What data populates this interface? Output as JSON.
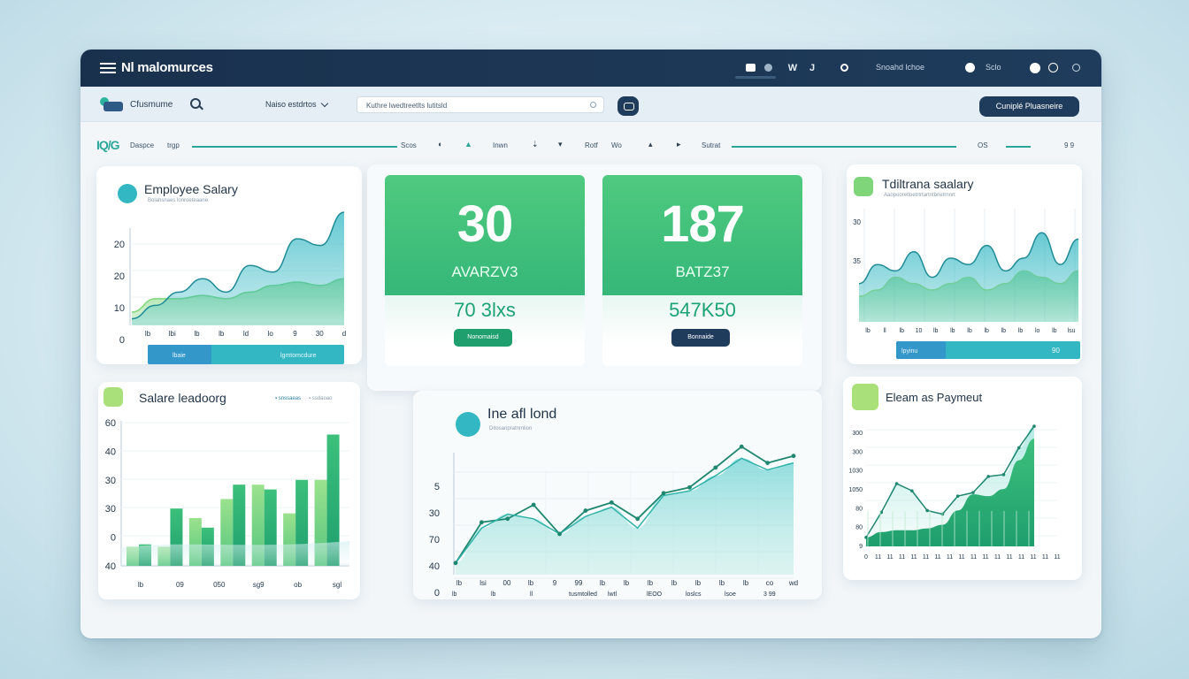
{
  "app": {
    "title": "Nl malomurces"
  },
  "titlebar": {
    "icons": [
      "window-icon",
      "record-icon",
      "w-icon",
      "j-icon",
      "help-icon",
      "globe-icon",
      "notification-icon",
      "status-icon"
    ],
    "w_text": "W",
    "j_text": "J",
    "status_text": "Snoahd lchoe",
    "lang_text": "Sclo",
    "colors": {
      "bar": "#1f3c5c",
      "text": "#ffffff"
    }
  },
  "toolbar": {
    "user_label": "Cfusmume",
    "dropdown_label": "Naiso estdrtos",
    "search_value": "Kuthre lwedtreetlts  lutitsld",
    "cta_label": "Cuniplé Pluasneire"
  },
  "filterbar": {
    "logo": "IQ/G",
    "items": [
      "Daspce",
      "trgp",
      "Scos",
      "Inwn",
      "Rotf",
      "Wo",
      "Sutrat",
      "OS"
    ],
    "page_indicator": "9 9"
  },
  "employee_salary": {
    "title": "Employee Salary",
    "subtitle": "Bolahsnaes lonroeteaane",
    "yticks": [
      "20",
      "20",
      "10",
      "0"
    ],
    "xticks": [
      "lb",
      "lbi",
      "lb",
      "lb",
      "ld",
      "lo",
      "9",
      "30",
      "d"
    ],
    "footer": [
      "lbaie",
      "lgmtomcdure"
    ],
    "chart_data": {
      "type": "area",
      "series": [
        {
          "values": [
            2,
            6,
            10,
            14,
            10,
            18,
            16,
            26,
            24,
            34
          ]
        },
        {
          "values": [
            4,
            8,
            8,
            9,
            8,
            10,
            12,
            13,
            12,
            14
          ]
        }
      ]
    },
    "colors": {
      "teal": "#33b8c3",
      "green": "#7fd67a"
    }
  },
  "stats": [
    {
      "value": "30",
      "label": "AVARZV3",
      "sub": "70 3lxs",
      "button": "Nonomaisd"
    },
    {
      "value": "187",
      "label": "BATZ37",
      "sub": "547K50",
      "button": "Bonnaide"
    }
  ],
  "traditional_salary": {
    "title": "Tdiltrana saalary",
    "subtitle": "Aaopooretloetrtrtartntbnetrnnrt",
    "yticks": [
      "30",
      "35"
    ],
    "xticks": [
      "lb",
      "ll",
      "lb",
      "10",
      "lb",
      "lb",
      "lb",
      "lb",
      "lb",
      "lb",
      "lo",
      "lb",
      "lsu"
    ],
    "footer": [
      "lpyinu",
      "90"
    ],
    "chart_data": {
      "type": "area",
      "series": [
        {
          "values": [
            12,
            18,
            16,
            22,
            14,
            20,
            18,
            24,
            16,
            20,
            28,
            18,
            26
          ]
        },
        {
          "values": [
            8,
            10,
            14,
            12,
            10,
            12,
            14,
            10,
            12,
            16,
            14,
            12,
            16
          ]
        }
      ]
    }
  },
  "salary_leadership": {
    "title": "Salare leadoorg",
    "legend": [
      "▪ snssaeas",
      "▪ ssdaoao"
    ],
    "yticks": [
      "60",
      "40",
      "30",
      "30",
      "0",
      "40"
    ],
    "xticks": [
      "lb",
      "09",
      "050",
      "sg9",
      "ob",
      "sgl"
    ],
    "chart_data": {
      "type": "bar",
      "series": [
        {
          "name": "light",
          "values": [
            8,
            8,
            20,
            28,
            34,
            22,
            36
          ]
        },
        {
          "name": "dark",
          "values": [
            9,
            24,
            16,
            34,
            32,
            36,
            55
          ]
        }
      ]
    }
  },
  "line_trend": {
    "title": "Ine afl lond",
    "subtitle": "Ditosanpratnmlion",
    "yticks": [
      "5",
      "30",
      "70",
      "40",
      "0"
    ],
    "xticks": [
      "lb",
      "lsi",
      "00",
      "lb",
      "9",
      "99",
      "lb",
      "lb",
      "lb",
      "lb",
      "lb",
      "lb",
      "lb",
      "co",
      "wd"
    ],
    "footer": [
      "lb",
      "lb",
      "ll",
      "tusmtolled",
      "lwtl",
      "lEOO",
      "loslcs",
      "lsoe",
      "3 99"
    ],
    "chart_data": {
      "type": "line",
      "series": [
        {
          "name": "a",
          "values": [
            10,
            45,
            48,
            60,
            35,
            55,
            62,
            48,
            70,
            75,
            92,
            110,
            96,
            102
          ]
        },
        {
          "name": "b",
          "values": [
            10,
            40,
            52,
            48,
            35,
            50,
            58,
            40,
            68,
            72,
            85,
            100,
            90,
            96
          ]
        }
      ]
    }
  },
  "payment": {
    "title": "Eleam as Paymeut",
    "yticks": [
      "300",
      "300",
      "1030",
      "1050",
      "80",
      "80",
      "9"
    ],
    "xticks": [
      "0",
      "11",
      "11",
      "11",
      "11",
      "11",
      "11",
      "11",
      "11",
      "11",
      "11",
      "11",
      "11",
      "11",
      "11",
      "11",
      "11"
    ],
    "chart_data": {
      "type": "area",
      "series": [
        {
          "values": [
            10,
            38,
            70,
            62,
            40,
            36,
            56,
            60,
            78,
            80,
            110,
            134
          ]
        },
        {
          "values": [
            10,
            16,
            18,
            18,
            20,
            24,
            40,
            58,
            56,
            64,
            96,
            120
          ]
        }
      ]
    }
  }
}
